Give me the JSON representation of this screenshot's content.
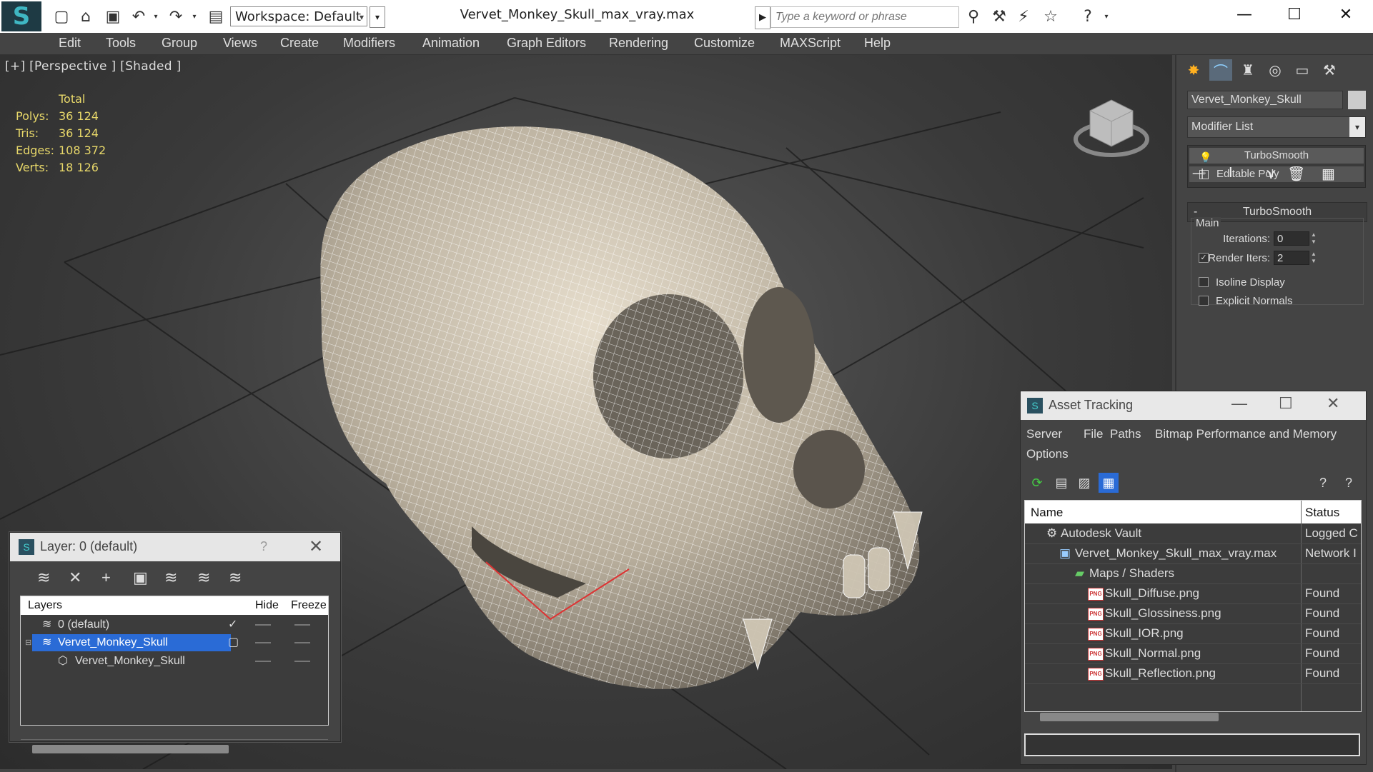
{
  "title_bar": {
    "workspace": "Workspace: Default",
    "file_title": "Vervet_Monkey_Skull_max_vray.max",
    "search_placeholder": "Type a keyword or phrase"
  },
  "menu": [
    "Edit",
    "Tools",
    "Group",
    "Views",
    "Create",
    "Modifiers",
    "Animation",
    "Graph Editors",
    "Rendering",
    "Customize",
    "MAXScript",
    "Help"
  ],
  "viewport": {
    "label": "[+] [Perspective ] [Shaded ]",
    "stats_header": "Total",
    "stats": [
      {
        "key": "Polys:",
        "value": "36 124"
      },
      {
        "key": "Tris:",
        "value": "36 124"
      },
      {
        "key": "Edges:",
        "value": "108 372"
      },
      {
        "key": "Verts:",
        "value": "18 126"
      }
    ]
  },
  "command_panel": {
    "object_name": "Vervet_Monkey_Skull",
    "modifier_list": "Modifier List",
    "stack": [
      "TurboSmooth",
      "Editable Poly"
    ],
    "rollout_title": "TurboSmooth",
    "group_main": "Main",
    "iterations_label": "Iterations:",
    "iterations_value": "0",
    "render_iters_label": "Render Iters:",
    "render_iters_value": "2",
    "isoline_label": "Isoline Display",
    "explicit_normals_label": "Explicit Normals"
  },
  "layer_dialog": {
    "title": "Layer: 0 (default)",
    "help": "?",
    "col_layers": "Layers",
    "col_hide": "Hide",
    "col_freeze": "Freeze",
    "rows": [
      {
        "name": "0 (default)"
      },
      {
        "name": "Vervet_Monkey_Skull"
      },
      {
        "name": "Vervet_Monkey_Skull"
      }
    ]
  },
  "asset_tracking": {
    "title": "Asset Tracking",
    "menu": [
      "Server",
      "File",
      "Paths",
      "Bitmap Performance and Memory",
      "Options"
    ],
    "col_name": "Name",
    "col_status": "Status",
    "rows": [
      {
        "name": "Autodesk Vault",
        "status": "Logged C"
      },
      {
        "name": "Vervet_Monkey_Skull_max_vray.max",
        "status": "Network I"
      },
      {
        "name": "Maps / Shaders",
        "status": ""
      },
      {
        "name": "Skull_Diffuse.png",
        "status": "Found"
      },
      {
        "name": "Skull_Glossiness.png",
        "status": "Found"
      },
      {
        "name": "Skull_IOR.png",
        "status": "Found"
      },
      {
        "name": "Skull_Normal.png",
        "status": "Found"
      },
      {
        "name": "Skull_Reflection.png",
        "status": "Found"
      }
    ]
  },
  "colors": {
    "stats_text": "#e8d86a",
    "selection": "#2a6bd6",
    "panel_bg": "#444444"
  }
}
